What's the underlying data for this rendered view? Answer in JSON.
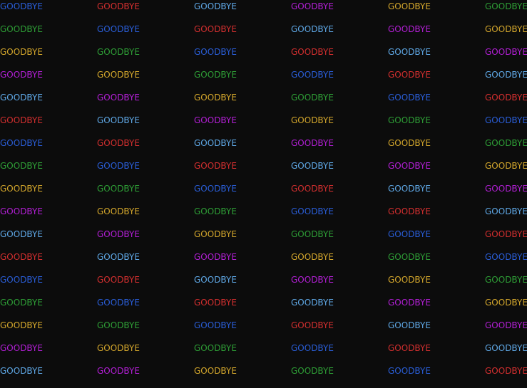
{
  "terminal": {
    "word": "GOODBYE",
    "palette": {
      "blue": "#2a5ed8",
      "red": "#d32f2f",
      "light-blue": "#5fa8e6",
      "magenta": "#b31fd6",
      "gold": "#d4a72c",
      "green": "#2e9e36"
    },
    "rows": [
      {
        "cells": [
          {
            "text": "GOODBYE",
            "color": "blue"
          },
          {
            "text": "GOODBYE",
            "color": "red"
          },
          {
            "text": "GOODBYE",
            "color": "light-blue"
          },
          {
            "text": "GOODBYE",
            "color": "magenta"
          },
          {
            "text": "GOODBYE",
            "color": "gold"
          },
          {
            "text": "GOODBYE",
            "color": "green"
          }
        ]
      },
      {
        "cells": [
          {
            "text": "GOODBYE",
            "color": "green"
          },
          {
            "text": "GOODBYE",
            "color": "blue"
          },
          {
            "text": "GOODBYE",
            "color": "red"
          },
          {
            "text": "GOODBYE",
            "color": "light-blue"
          },
          {
            "text": "GOODBYE",
            "color": "magenta"
          },
          {
            "text": "GOODBYE",
            "color": "gold"
          }
        ]
      },
      {
        "cells": [
          {
            "text": "GOODBYE",
            "color": "gold"
          },
          {
            "text": "GOODBYE",
            "color": "green"
          },
          {
            "text": "GOODBYE",
            "color": "blue"
          },
          {
            "text": "GOODBYE",
            "color": "red"
          },
          {
            "text": "GOODBYE",
            "color": "light-blue"
          },
          {
            "text": "GOODBYE",
            "color": "magenta"
          }
        ]
      },
      {
        "cells": [
          {
            "text": "GOODBYE",
            "color": "magenta"
          },
          {
            "text": "GOODBYE",
            "color": "gold"
          },
          {
            "text": "GOODBYE",
            "color": "green"
          },
          {
            "text": "GOODBYE",
            "color": "blue"
          },
          {
            "text": "GOODBYE",
            "color": "red"
          },
          {
            "text": "GOODBYE",
            "color": "light-blue"
          }
        ]
      },
      {
        "cells": [
          {
            "text": "GOODBYE",
            "color": "light-blue"
          },
          {
            "text": "GOODBYE",
            "color": "magenta"
          },
          {
            "text": "GOODBYE",
            "color": "gold"
          },
          {
            "text": "GOODBYE",
            "color": "green"
          },
          {
            "text": "GOODBYE",
            "color": "blue"
          },
          {
            "text": "GOODBYE",
            "color": "red"
          }
        ]
      },
      {
        "cells": [
          {
            "text": "GOODBYE",
            "color": "red"
          },
          {
            "text": "GOODBYE",
            "color": "light-blue"
          },
          {
            "text": "GOODBYE",
            "color": "magenta"
          },
          {
            "text": "GOODBYE",
            "color": "gold"
          },
          {
            "text": "GOODBYE",
            "color": "green"
          },
          {
            "text": "GOODBYE",
            "color": "blue"
          }
        ]
      },
      {
        "cells": [
          {
            "text": "GOODBYE",
            "color": "blue"
          },
          {
            "text": "GOODBYE",
            "color": "red"
          },
          {
            "text": "GOODBYE",
            "color": "light-blue"
          },
          {
            "text": "GOODBYE",
            "color": "magenta"
          },
          {
            "text": "GOODBYE",
            "color": "gold"
          },
          {
            "text": "GOODBYE",
            "color": "green"
          }
        ]
      },
      {
        "cells": [
          {
            "text": "GOODBYE",
            "color": "green"
          },
          {
            "text": "GOODBYE",
            "color": "blue"
          },
          {
            "text": "GOODBYE",
            "color": "red"
          },
          {
            "text": "GOODBYE",
            "color": "light-blue"
          },
          {
            "text": "GOODBYE",
            "color": "magenta"
          },
          {
            "text": "GOODBYE",
            "color": "gold"
          }
        ]
      },
      {
        "cells": [
          {
            "text": "GOODBYE",
            "color": "gold"
          },
          {
            "text": "GOODBYE",
            "color": "green"
          },
          {
            "text": "GOODBYE",
            "color": "blue"
          },
          {
            "text": "GOODBYE",
            "color": "red"
          },
          {
            "text": "GOODBYE",
            "color": "light-blue"
          },
          {
            "text": "GOODBYE",
            "color": "magenta"
          }
        ]
      },
      {
        "cells": [
          {
            "text": "GOODBYE",
            "color": "magenta"
          },
          {
            "text": "GOODBYE",
            "color": "gold"
          },
          {
            "text": "GOODBYE",
            "color": "green"
          },
          {
            "text": "GOODBYE",
            "color": "blue"
          },
          {
            "text": "GOODBYE",
            "color": "red"
          },
          {
            "text": "GOODBYE",
            "color": "light-blue"
          }
        ]
      },
      {
        "cells": [
          {
            "text": "GOODBYE",
            "color": "light-blue"
          },
          {
            "text": "GOODBYE",
            "color": "magenta"
          },
          {
            "text": "GOODBYE",
            "color": "gold"
          },
          {
            "text": "GOODBYE",
            "color": "green"
          },
          {
            "text": "GOODBYE",
            "color": "blue"
          },
          {
            "text": "GOODBYE",
            "color": "red"
          }
        ]
      },
      {
        "cells": [
          {
            "text": "GOODBYE",
            "color": "red"
          },
          {
            "text": "GOODBYE",
            "color": "light-blue"
          },
          {
            "text": "GOODBYE",
            "color": "magenta"
          },
          {
            "text": "GOODBYE",
            "color": "gold"
          },
          {
            "text": "GOODBYE",
            "color": "green"
          },
          {
            "text": "GOODBYE",
            "color": "blue"
          }
        ]
      },
      {
        "cells": [
          {
            "text": "GOODBYE",
            "color": "blue"
          },
          {
            "text": "GOODBYE",
            "color": "red"
          },
          {
            "text": "GOODBYE",
            "color": "light-blue"
          },
          {
            "text": "GOODBYE",
            "color": "magenta"
          },
          {
            "text": "GOODBYE",
            "color": "gold"
          },
          {
            "text": "GOODBYE",
            "color": "green"
          }
        ]
      },
      {
        "cells": [
          {
            "text": "GOODBYE",
            "color": "green"
          },
          {
            "text": "GOODBYE",
            "color": "blue"
          },
          {
            "text": "GOODBYE",
            "color": "red"
          },
          {
            "text": "GOODBYE",
            "color": "light-blue"
          },
          {
            "text": "GOODBYE",
            "color": "magenta"
          },
          {
            "text": "GOODBYE",
            "color": "gold"
          }
        ]
      },
      {
        "cells": [
          {
            "text": "GOODBYE",
            "color": "gold"
          },
          {
            "text": "GOODBYE",
            "color": "green"
          },
          {
            "text": "GOODBYE",
            "color": "blue"
          },
          {
            "text": "GOODBYE",
            "color": "red"
          },
          {
            "text": "GOODBYE",
            "color": "light-blue"
          },
          {
            "text": "GOODBYE",
            "color": "magenta"
          }
        ]
      },
      {
        "cells": [
          {
            "text": "GOODBYE",
            "color": "magenta"
          },
          {
            "text": "GOODBYE",
            "color": "gold"
          },
          {
            "text": "GOODBYE",
            "color": "green"
          },
          {
            "text": "GOODBYE",
            "color": "blue"
          },
          {
            "text": "GOODBYE",
            "color": "red"
          },
          {
            "text": "GOODBYE",
            "color": "light-blue"
          }
        ]
      },
      {
        "cells": [
          {
            "text": "GOODBYE",
            "color": "light-blue"
          },
          {
            "text": "GOODBYE",
            "color": "magenta"
          },
          {
            "text": "GOODBYE",
            "color": "gold"
          },
          {
            "text": "GOODBYE",
            "color": "green"
          },
          {
            "text": "GOODBYE",
            "color": "blue"
          },
          {
            "text": "GOODBYE",
            "color": "red"
          }
        ]
      }
    ]
  }
}
